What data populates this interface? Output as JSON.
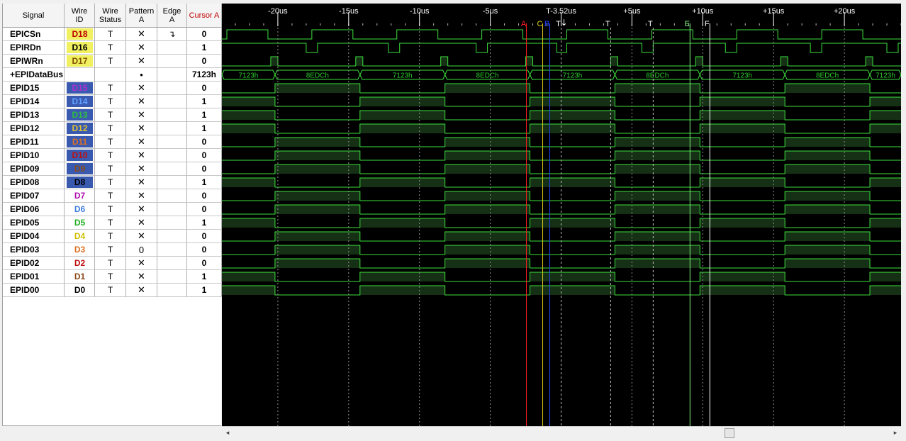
{
  "headers": {
    "signal": "Signal",
    "wire_id": "Wire ID",
    "wire_status": "Wire Status",
    "pattern": "Pattern A",
    "edge": "Edge A",
    "cursor": "Cursor A"
  },
  "colors": {
    "wave": "#3de03d",
    "wave_fill": "#153015",
    "bus_text": "#2bc82b",
    "cursor_A": "#ff2020",
    "cursor_C": "#e0d020",
    "cursor_B": "#2040ff",
    "cursor_T": "#ffffff",
    "cursor_E": "#80f080",
    "cursor_header": "#c00000"
  },
  "signals": [
    {
      "name": "EPICSn",
      "wire": "D18",
      "wire_fg": "#c00000",
      "wire_bg": "#f0f060",
      "status": "T",
      "pattern": "✕",
      "edge": "↴",
      "cursor": "0"
    },
    {
      "name": "EPIRDn",
      "wire": "D16",
      "wire_fg": "#000000",
      "wire_bg": "#f0f060",
      "status": "T",
      "pattern": "✕",
      "edge": "",
      "cursor": "1"
    },
    {
      "name": "EPIWRn",
      "wire": "D17",
      "wire_fg": "#805000",
      "wire_bg": "#f0f060",
      "status": "T",
      "pattern": "✕",
      "edge": "",
      "cursor": "0"
    },
    {
      "name": "+EPIDataBus",
      "wire": "",
      "wire_fg": "#000000",
      "wire_bg": "",
      "status": "",
      "pattern": "•",
      "edge": "",
      "cursor": "7123h"
    },
    {
      "name": "EPID15",
      "wire": "D15",
      "wire_fg": "#b030d0",
      "wire_bg": "#3a5ab0",
      "status": "T",
      "pattern": "✕",
      "edge": "",
      "cursor": "0"
    },
    {
      "name": "EPID14",
      "wire": "D14",
      "wire_fg": "#60a0ff",
      "wire_bg": "#3a5ab0",
      "status": "T",
      "pattern": "✕",
      "edge": "",
      "cursor": "1"
    },
    {
      "name": "EPID13",
      "wire": "D13",
      "wire_fg": "#30c040",
      "wire_bg": "#3a5ab0",
      "status": "T",
      "pattern": "✕",
      "edge": "",
      "cursor": "1"
    },
    {
      "name": "EPID12",
      "wire": "D12",
      "wire_fg": "#e0c030",
      "wire_bg": "#3a5ab0",
      "status": "T",
      "pattern": "✕",
      "edge": "",
      "cursor": "1"
    },
    {
      "name": "EPID11",
      "wire": "D11",
      "wire_fg": "#e07020",
      "wire_bg": "#3a5ab0",
      "status": "T",
      "pattern": "✕",
      "edge": "",
      "cursor": "0"
    },
    {
      "name": "EPID10",
      "wire": "D10",
      "wire_fg": "#c01010",
      "wire_bg": "#3a5ab0",
      "status": "T",
      "pattern": "✕",
      "edge": "",
      "cursor": "0"
    },
    {
      "name": "EPID09",
      "wire": "D9",
      "wire_fg": "#8a4a1a",
      "wire_bg": "#3a5ab0",
      "status": "T",
      "pattern": "✕",
      "edge": "",
      "cursor": "0"
    },
    {
      "name": "EPID08",
      "wire": "D8",
      "wire_fg": "#000000",
      "wire_bg": "#3a5ab0",
      "status": "T",
      "pattern": "✕",
      "edge": "",
      "cursor": "1"
    },
    {
      "name": "EPID07",
      "wire": "D7",
      "wire_fg": "#b010b0",
      "wire_bg": "",
      "status": "T",
      "pattern": "✕",
      "edge": "",
      "cursor": "0"
    },
    {
      "name": "EPID06",
      "wire": "D6",
      "wire_fg": "#4080e0",
      "wire_bg": "",
      "status": "T",
      "pattern": "✕",
      "edge": "",
      "cursor": "0"
    },
    {
      "name": "EPID05",
      "wire": "D5",
      "wire_fg": "#20b020",
      "wire_bg": "",
      "status": "T",
      "pattern": "✕",
      "edge": "",
      "cursor": "1"
    },
    {
      "name": "EPID04",
      "wire": "D4",
      "wire_fg": "#d0c000",
      "wire_bg": "",
      "status": "T",
      "pattern": "✕",
      "edge": "",
      "cursor": "0"
    },
    {
      "name": "EPID03",
      "wire": "D3",
      "wire_fg": "#e07020",
      "wire_bg": "",
      "status": "T",
      "pattern": "0",
      "edge": "",
      "cursor": "0"
    },
    {
      "name": "EPID02",
      "wire": "D2",
      "wire_fg": "#c01010",
      "wire_bg": "",
      "status": "T",
      "pattern": "✕",
      "edge": "",
      "cursor": "0"
    },
    {
      "name": "EPID01",
      "wire": "D1",
      "wire_fg": "#8a4a1a",
      "wire_bg": "",
      "status": "T",
      "pattern": "✕",
      "edge": "",
      "cursor": "1"
    },
    {
      "name": "EPID00",
      "wire": "D0",
      "wire_fg": "#000000",
      "wire_bg": "",
      "status": "T",
      "pattern": "✕",
      "edge": "",
      "cursor": "1"
    }
  ],
  "waveform": {
    "t_start_us": -23.95,
    "t_end_us": 24.0,
    "time_labels": [
      "-20us",
      "-15us",
      "-10us",
      "-5us",
      "T-3.52us",
      "+5us",
      "+10us",
      "+15us",
      "+20us"
    ],
    "time_label_values_us": [
      -20,
      -15,
      -10,
      -5,
      0,
      5,
      10,
      15,
      20
    ],
    "cursors": [
      {
        "name": "A",
        "t_us": -2.45,
        "color": "#ff2020"
      },
      {
        "name": "C",
        "t_us": -1.3,
        "color": "#e0d020"
      },
      {
        "name": "B",
        "t_us": -0.8,
        "color": "#2040ff"
      },
      {
        "name": "T",
        "t_us": 0,
        "color": "#ffffff",
        "marker": "↓"
      },
      {
        "name": "T",
        "t_us": 3.5,
        "color": "#ffffff",
        "marker": ""
      },
      {
        "name": "T",
        "t_us": 6.5,
        "color": "#ffffff",
        "marker": ""
      },
      {
        "name": "E",
        "t_us": 9.1,
        "color": "#80f080"
      },
      {
        "name": "F",
        "t_us": 10.5,
        "color": "#ffffff"
      }
    ],
    "bus_segments": [
      {
        "t0": -23.95,
        "t1": -20.2,
        "label": "7123h"
      },
      {
        "t0": -20.2,
        "t1": -14.2,
        "label": "8EDCh"
      },
      {
        "t0": -14.2,
        "t1": -8.2,
        "label": "7123h"
      },
      {
        "t0": -8.2,
        "t1": -2.2,
        "label": "8EDCh"
      },
      {
        "t0": -2.2,
        "t1": 3.8,
        "label": "7123h"
      },
      {
        "t0": 3.8,
        "t1": 9.8,
        "label": "8EDCh"
      },
      {
        "t0": 9.8,
        "t1": 15.8,
        "label": "7123h"
      },
      {
        "t0": 15.8,
        "t1": 21.8,
        "label": "8EDCh"
      },
      {
        "t0": 21.8,
        "t1": 24.0,
        "label": "7123h"
      }
    ],
    "signal_transitions": {
      "EPICSn": {
        "initial": 0,
        "edges": [
          -23.6,
          -20.7,
          -17.6,
          -14.7,
          -11.6,
          -8.7,
          -5.6,
          -2.7,
          0.4,
          3.3,
          6.4,
          9.3,
          12.4,
          15.3,
          18.4,
          21.3
        ]
      },
      "EPIRDn": {
        "initial": 1,
        "edges": [
          -18.0,
          -17.2,
          -12.2,
          -11.4,
          -6.0,
          -5.2,
          -0.3,
          0.4,
          5.7,
          6.5,
          11.6,
          12.4,
          17.6,
          18.4,
          23.0,
          23.8
        ]
      },
      "EPIWRn": {
        "initial": 0,
        "edges": [
          -20.5,
          -20.0,
          -14.5,
          -14.0,
          -8.5,
          -8.0,
          -2.5,
          -2.0,
          3.5,
          4.0,
          9.5,
          10.0,
          15.5,
          16.0,
          21.5,
          22.0
        ]
      },
      "patA": {
        "initial": 0,
        "edges": [
          -20.2,
          -14.2,
          -8.2,
          -2.2,
          3.8,
          9.8,
          15.8,
          21.8
        ]
      },
      "patB": {
        "initial": 1,
        "edges": [
          -20.2,
          -14.2,
          -8.2,
          -2.2,
          3.8,
          9.8,
          15.8,
          21.8
        ]
      }
    }
  }
}
